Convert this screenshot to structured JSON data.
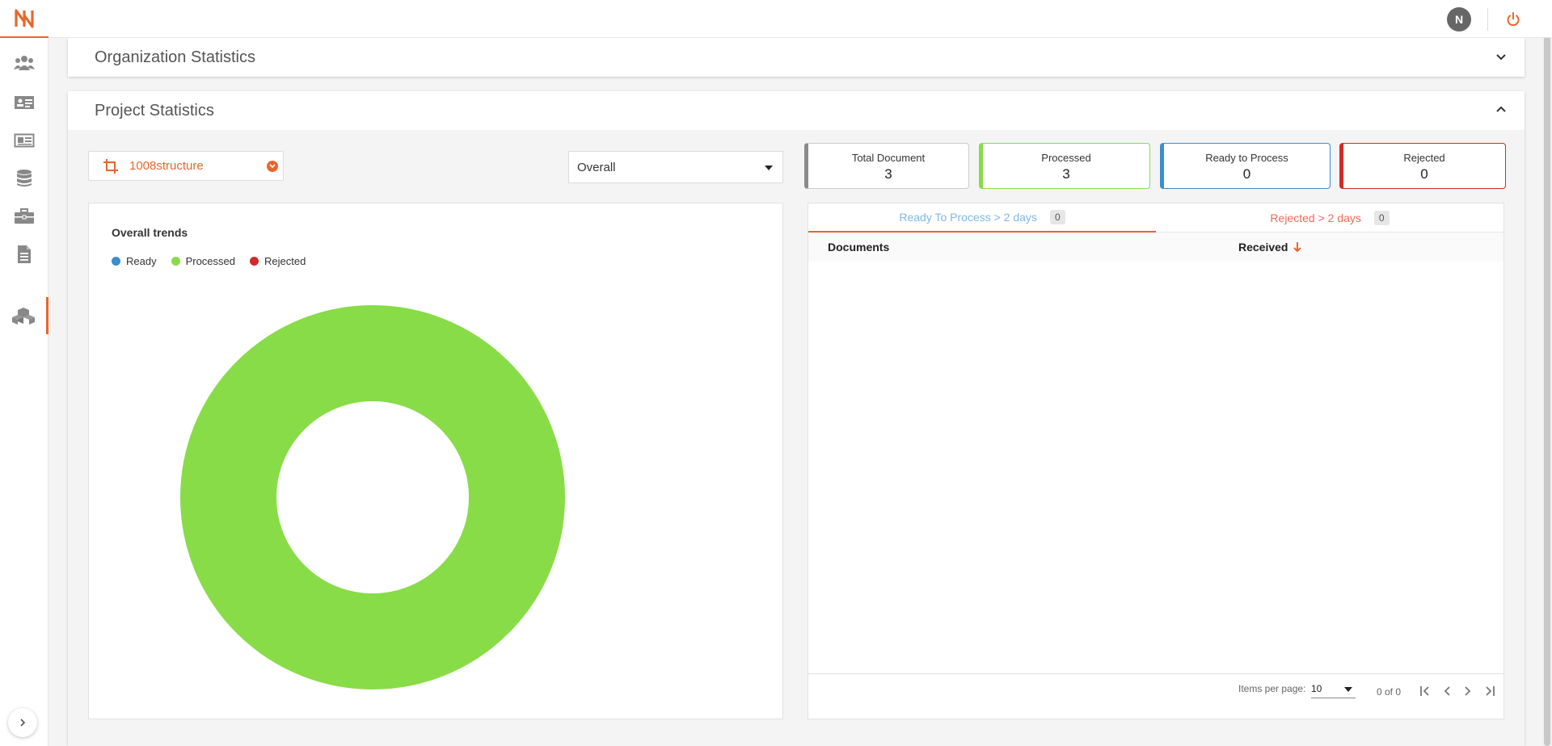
{
  "header": {
    "user_initial": "N"
  },
  "sidebar": {
    "items": [
      {
        "icon": "users-icon"
      },
      {
        "icon": "id-card-icon"
      },
      {
        "icon": "newspaper-icon"
      },
      {
        "icon": "database-icon"
      },
      {
        "icon": "briefcase-icon"
      },
      {
        "icon": "document-icon"
      },
      {
        "icon": "boxes-icon",
        "active": true
      }
    ]
  },
  "org_stats": {
    "title": "Organization Statistics"
  },
  "project_stats": {
    "title": "Project Statistics",
    "project_name": "1008structure",
    "period": "Overall",
    "cards": [
      {
        "label": "Total Document",
        "value": "3",
        "color": "#8a8a8a"
      },
      {
        "label": "Processed",
        "value": "3",
        "color": "#88dc48"
      },
      {
        "label": "Ready to Process",
        "value": "0",
        "color": "#3a8fcf"
      },
      {
        "label": "Rejected",
        "value": "0",
        "color": "#d12a2a"
      }
    ]
  },
  "chart_data": {
    "type": "pie",
    "title": "Overall trends",
    "legend_position": "top-left",
    "categories": [
      "Ready",
      "Processed",
      "Rejected"
    ],
    "values": [
      0,
      3,
      0
    ],
    "colors": [
      "#3a8fcf",
      "#88dc48",
      "#d12a2a"
    ]
  },
  "table": {
    "tabs": [
      {
        "label": "Ready To Process > 2 days",
        "count": "0",
        "color": "#7fb8e0"
      },
      {
        "label": "Rejected > 2 days",
        "count": "0",
        "color": "#ef6a5a"
      }
    ],
    "columns": [
      "Documents",
      "Received"
    ],
    "rows": [],
    "pagination": {
      "items_per_page_label": "Items per page:",
      "items_per_page": "10",
      "range": "0 of 0"
    }
  }
}
